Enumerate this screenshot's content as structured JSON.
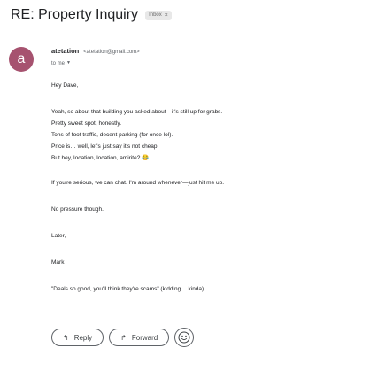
{
  "email": {
    "subject": "RE: Property Inquiry",
    "label": "Inbox",
    "label_remove": "×",
    "avatar_letter": "a",
    "avatar_color": "#a6526f",
    "sender_name": "atetation",
    "sender_email": "<atetation@gmail.com>",
    "recipient": "to me",
    "body": [
      "Hey Dave,",
      "Yeah, so about that building you asked about—it's still up for grabs.",
      "Pretty sweet spot, honestly.",
      "Tons of foot traffic, decent parking (for once lol).",
      "Price is… well, let's just say it's not cheap.",
      "But hey, location, location, amirite? 😂",
      "If you're serious, we can chat. I'm around whenever—just hit me up.",
      "No pressure though.",
      "Later,",
      "Mark",
      "\"Deals so good, you'll think they're scams\" (kidding… kinda)"
    ]
  },
  "actions": {
    "reply_label": "Reply",
    "forward_label": "Forward"
  }
}
